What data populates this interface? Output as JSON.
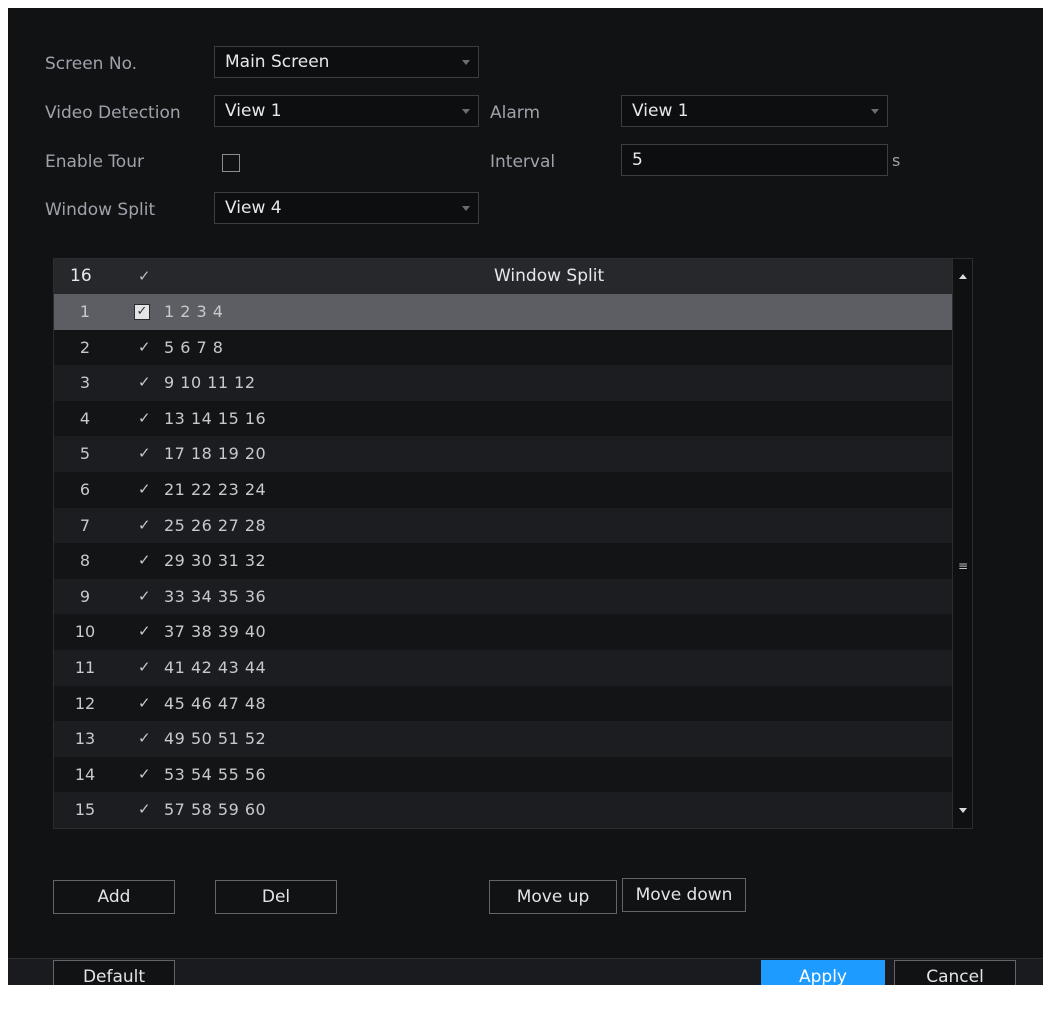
{
  "form": {
    "screen_no_label": "Screen No.",
    "screen_no_value": "Main Screen",
    "video_detection_label": "Video Detection",
    "video_detection_value": "View 1",
    "alarm_label": "Alarm",
    "alarm_value": "View 1",
    "enable_tour_label": "Enable Tour",
    "enable_tour_checked": false,
    "interval_label": "Interval",
    "interval_value": "5",
    "interval_unit": "s",
    "window_split_label": "Window Split",
    "window_split_value": "View 4"
  },
  "table": {
    "header_count": "16",
    "header_check": "✓",
    "header_title": "Window Split",
    "rows": [
      {
        "num": "1",
        "check": "✓",
        "value": "1 2 3 4",
        "selected": true
      },
      {
        "num": "2",
        "check": "✓",
        "value": "5 6 7 8"
      },
      {
        "num": "3",
        "check": "✓",
        "value": "9 10 11 12"
      },
      {
        "num": "4",
        "check": "✓",
        "value": "13 14 15 16"
      },
      {
        "num": "5",
        "check": "✓",
        "value": "17 18 19 20"
      },
      {
        "num": "6",
        "check": "✓",
        "value": "21 22 23 24"
      },
      {
        "num": "7",
        "check": "✓",
        "value": "25 26 27 28"
      },
      {
        "num": "8",
        "check": "✓",
        "value": "29 30 31 32"
      },
      {
        "num": "9",
        "check": "✓",
        "value": "33 34 35 36"
      },
      {
        "num": "10",
        "check": "✓",
        "value": "37 38 39 40"
      },
      {
        "num": "11",
        "check": "✓",
        "value": "41 42 43 44"
      },
      {
        "num": "12",
        "check": "✓",
        "value": "45 46 47 48"
      },
      {
        "num": "13",
        "check": "✓",
        "value": "49 50 51 52"
      },
      {
        "num": "14",
        "check": "✓",
        "value": "53 54 55 56"
      },
      {
        "num": "15",
        "check": "✓",
        "value": "57 58 59 60"
      }
    ]
  },
  "buttons": {
    "add": "Add",
    "del": "Del",
    "move_up": "Move up",
    "move_down": "Move down",
    "default": "Default",
    "apply": "Apply",
    "cancel": "Cancel"
  },
  "colors": {
    "panel_bg": "#111214",
    "accent": "#1e9bff",
    "selected_row": "#5c5e63"
  },
  "icons": {
    "dropdown": "caret-down-icon",
    "scroll_up": "caret-up-icon",
    "scroll_down": "caret-down-icon",
    "scroll_grip": "grip-lines-icon"
  }
}
